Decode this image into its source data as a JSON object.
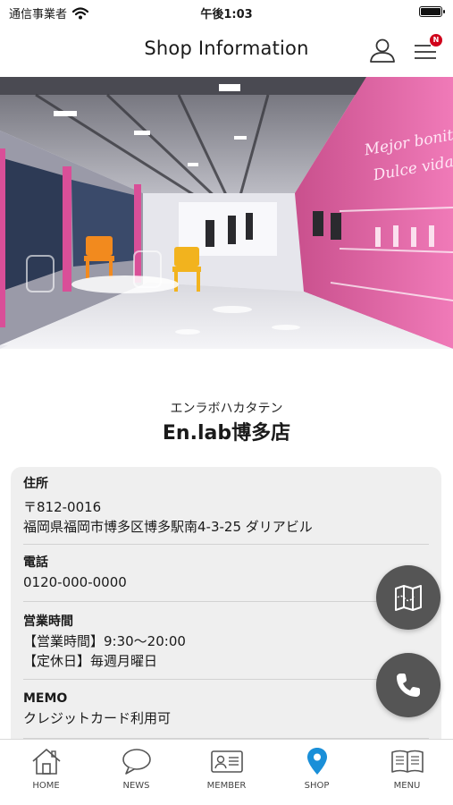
{
  "status_bar": {
    "carrier": "通信事業者",
    "time": "午後1:03"
  },
  "header": {
    "title": "Shop Information",
    "badge": "N"
  },
  "shop": {
    "name_kana": "エンラボハカタテン",
    "name": "En.lab博多店",
    "photo_sign_text": "Mejor bonita Dulce vida"
  },
  "info": {
    "address": {
      "label": "住所",
      "postal": "〒812-0016",
      "line": "福岡県福岡市博多区博多駅南4-3-25 ダリアビル"
    },
    "phone": {
      "label": "電話",
      "value": "0120-000-0000"
    },
    "hours": {
      "label": "営業時間",
      "line1": "【営業時間】9:30〜20:00",
      "line2": "【定休日】毎週月曜日"
    },
    "memo": {
      "label": "MEMO",
      "value": "クレジットカード利用可"
    }
  },
  "tabs": [
    {
      "label": "HOME",
      "icon": "home-icon"
    },
    {
      "label": "NEWS",
      "icon": "speech-bubble-icon"
    },
    {
      "label": "MEMBER",
      "icon": "member-card-icon"
    },
    {
      "label": "SHOP",
      "icon": "location-pin-icon"
    },
    {
      "label": "MENU",
      "icon": "book-icon"
    }
  ],
  "colors": {
    "active_tab": "#1a8fd8",
    "fab": "#555555",
    "badge": "#d0021b",
    "card_bg": "#efefef"
  }
}
